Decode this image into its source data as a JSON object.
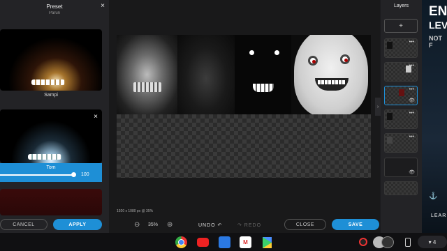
{
  "preset_panel": {
    "title": "Preset",
    "close_icon": "×",
    "prev_label": "Parun",
    "items": [
      {
        "label": "Sampi"
      },
      {
        "label": "Tom",
        "value": "100",
        "close_icon": "×"
      }
    ],
    "cancel_label": "CANCEL",
    "apply_label": "APPLY"
  },
  "canvas": {
    "size_label": "1920 x 1080 px @ 35%"
  },
  "toolbar": {
    "zoom_out_icon": "⊖",
    "zoom_value": "35%",
    "zoom_in_icon": "⊕",
    "undo_label": "UNDO ↶",
    "redo_label": "↷ REDO",
    "close_label": "CLOSE",
    "save_label": "SAVE"
  },
  "layers_panel": {
    "title": "Layers",
    "add_icon": "+",
    "collapse_icon": "›",
    "dots": "•••",
    "visibility_icon": "👁"
  },
  "ad": {
    "line1": "EN",
    "line2": "LEV",
    "line3": "NOT F",
    "emblem": "⚓",
    "cta": "LEAR"
  },
  "taskbar": {
    "gmail_glyph": "M",
    "status": "▾ 4"
  },
  "colors": {
    "accent": "#1e8fd6",
    "panel": "#232326",
    "background": "#19191a"
  }
}
